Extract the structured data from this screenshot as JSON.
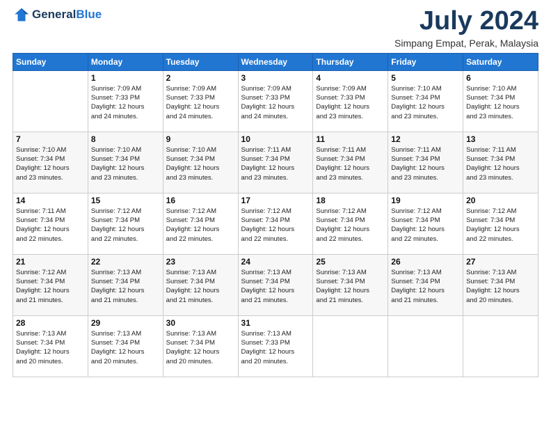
{
  "logo": {
    "general": "General",
    "blue": "Blue"
  },
  "header": {
    "month": "July 2024",
    "location": "Simpang Empat, Perak, Malaysia"
  },
  "weekdays": [
    "Sunday",
    "Monday",
    "Tuesday",
    "Wednesday",
    "Thursday",
    "Friday",
    "Saturday"
  ],
  "weeks": [
    [
      {
        "day": "",
        "sunrise": "",
        "sunset": "",
        "daylight": ""
      },
      {
        "day": "1",
        "sunrise": "Sunrise: 7:09 AM",
        "sunset": "Sunset: 7:33 PM",
        "daylight": "Daylight: 12 hours and 24 minutes."
      },
      {
        "day": "2",
        "sunrise": "Sunrise: 7:09 AM",
        "sunset": "Sunset: 7:33 PM",
        "daylight": "Daylight: 12 hours and 24 minutes."
      },
      {
        "day": "3",
        "sunrise": "Sunrise: 7:09 AM",
        "sunset": "Sunset: 7:33 PM",
        "daylight": "Daylight: 12 hours and 24 minutes."
      },
      {
        "day": "4",
        "sunrise": "Sunrise: 7:09 AM",
        "sunset": "Sunset: 7:33 PM",
        "daylight": "Daylight: 12 hours and 23 minutes."
      },
      {
        "day": "5",
        "sunrise": "Sunrise: 7:10 AM",
        "sunset": "Sunset: 7:34 PM",
        "daylight": "Daylight: 12 hours and 23 minutes."
      },
      {
        "day": "6",
        "sunrise": "Sunrise: 7:10 AM",
        "sunset": "Sunset: 7:34 PM",
        "daylight": "Daylight: 12 hours and 23 minutes."
      }
    ],
    [
      {
        "day": "7",
        "sunrise": "Sunrise: 7:10 AM",
        "sunset": "Sunset: 7:34 PM",
        "daylight": "Daylight: 12 hours and 23 minutes."
      },
      {
        "day": "8",
        "sunrise": "Sunrise: 7:10 AM",
        "sunset": "Sunset: 7:34 PM",
        "daylight": "Daylight: 12 hours and 23 minutes."
      },
      {
        "day": "9",
        "sunrise": "Sunrise: 7:10 AM",
        "sunset": "Sunset: 7:34 PM",
        "daylight": "Daylight: 12 hours and 23 minutes."
      },
      {
        "day": "10",
        "sunrise": "Sunrise: 7:11 AM",
        "sunset": "Sunset: 7:34 PM",
        "daylight": "Daylight: 12 hours and 23 minutes."
      },
      {
        "day": "11",
        "sunrise": "Sunrise: 7:11 AM",
        "sunset": "Sunset: 7:34 PM",
        "daylight": "Daylight: 12 hours and 23 minutes."
      },
      {
        "day": "12",
        "sunrise": "Sunrise: 7:11 AM",
        "sunset": "Sunset: 7:34 PM",
        "daylight": "Daylight: 12 hours and 23 minutes."
      },
      {
        "day": "13",
        "sunrise": "Sunrise: 7:11 AM",
        "sunset": "Sunset: 7:34 PM",
        "daylight": "Daylight: 12 hours and 23 minutes."
      }
    ],
    [
      {
        "day": "14",
        "sunrise": "Sunrise: 7:11 AM",
        "sunset": "Sunset: 7:34 PM",
        "daylight": "Daylight: 12 hours and 22 minutes."
      },
      {
        "day": "15",
        "sunrise": "Sunrise: 7:12 AM",
        "sunset": "Sunset: 7:34 PM",
        "daylight": "Daylight: 12 hours and 22 minutes."
      },
      {
        "day": "16",
        "sunrise": "Sunrise: 7:12 AM",
        "sunset": "Sunset: 7:34 PM",
        "daylight": "Daylight: 12 hours and 22 minutes."
      },
      {
        "day": "17",
        "sunrise": "Sunrise: 7:12 AM",
        "sunset": "Sunset: 7:34 PM",
        "daylight": "Daylight: 12 hours and 22 minutes."
      },
      {
        "day": "18",
        "sunrise": "Sunrise: 7:12 AM",
        "sunset": "Sunset: 7:34 PM",
        "daylight": "Daylight: 12 hours and 22 minutes."
      },
      {
        "day": "19",
        "sunrise": "Sunrise: 7:12 AM",
        "sunset": "Sunset: 7:34 PM",
        "daylight": "Daylight: 12 hours and 22 minutes."
      },
      {
        "day": "20",
        "sunrise": "Sunrise: 7:12 AM",
        "sunset": "Sunset: 7:34 PM",
        "daylight": "Daylight: 12 hours and 22 minutes."
      }
    ],
    [
      {
        "day": "21",
        "sunrise": "Sunrise: 7:12 AM",
        "sunset": "Sunset: 7:34 PM",
        "daylight": "Daylight: 12 hours and 21 minutes."
      },
      {
        "day": "22",
        "sunrise": "Sunrise: 7:13 AM",
        "sunset": "Sunset: 7:34 PM",
        "daylight": "Daylight: 12 hours and 21 minutes."
      },
      {
        "day": "23",
        "sunrise": "Sunrise: 7:13 AM",
        "sunset": "Sunset: 7:34 PM",
        "daylight": "Daylight: 12 hours and 21 minutes."
      },
      {
        "day": "24",
        "sunrise": "Sunrise: 7:13 AM",
        "sunset": "Sunset: 7:34 PM",
        "daylight": "Daylight: 12 hours and 21 minutes."
      },
      {
        "day": "25",
        "sunrise": "Sunrise: 7:13 AM",
        "sunset": "Sunset: 7:34 PM",
        "daylight": "Daylight: 12 hours and 21 minutes."
      },
      {
        "day": "26",
        "sunrise": "Sunrise: 7:13 AM",
        "sunset": "Sunset: 7:34 PM",
        "daylight": "Daylight: 12 hours and 21 minutes."
      },
      {
        "day": "27",
        "sunrise": "Sunrise: 7:13 AM",
        "sunset": "Sunset: 7:34 PM",
        "daylight": "Daylight: 12 hours and 20 minutes."
      }
    ],
    [
      {
        "day": "28",
        "sunrise": "Sunrise: 7:13 AM",
        "sunset": "Sunset: 7:34 PM",
        "daylight": "Daylight: 12 hours and 20 minutes."
      },
      {
        "day": "29",
        "sunrise": "Sunrise: 7:13 AM",
        "sunset": "Sunset: 7:34 PM",
        "daylight": "Daylight: 12 hours and 20 minutes."
      },
      {
        "day": "30",
        "sunrise": "Sunrise: 7:13 AM",
        "sunset": "Sunset: 7:34 PM",
        "daylight": "Daylight: 12 hours and 20 minutes."
      },
      {
        "day": "31",
        "sunrise": "Sunrise: 7:13 AM",
        "sunset": "Sunset: 7:33 PM",
        "daylight": "Daylight: 12 hours and 20 minutes."
      },
      {
        "day": "",
        "sunrise": "",
        "sunset": "",
        "daylight": ""
      },
      {
        "day": "",
        "sunrise": "",
        "sunset": "",
        "daylight": ""
      },
      {
        "day": "",
        "sunrise": "",
        "sunset": "",
        "daylight": ""
      }
    ]
  ]
}
